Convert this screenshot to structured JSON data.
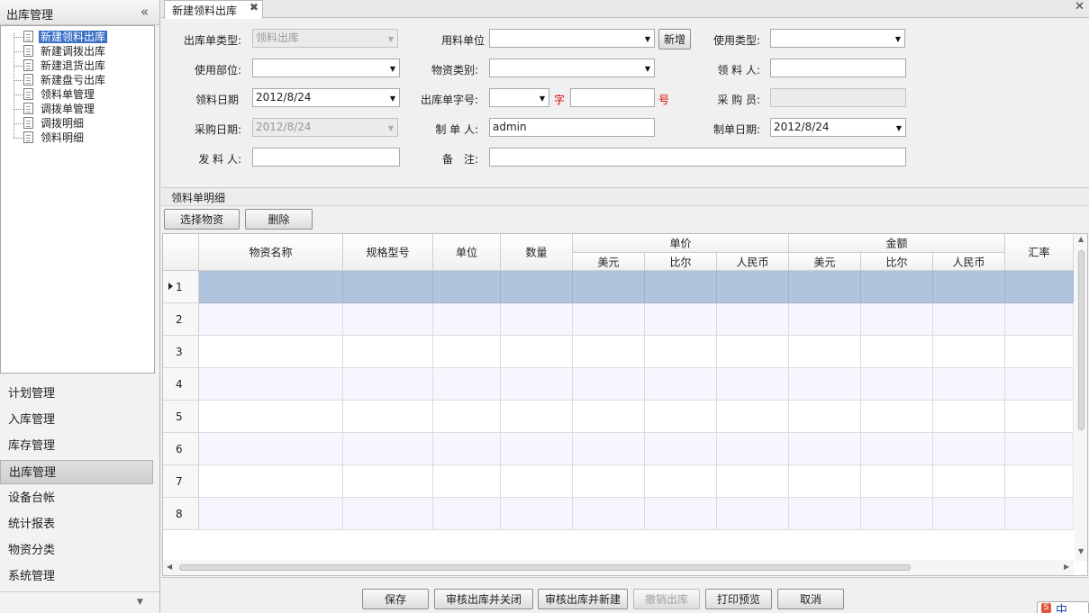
{
  "sidebar": {
    "title": "出库管理",
    "collapse_icon": "«",
    "tree": [
      {
        "label": "新建领料出库",
        "selected": true
      },
      {
        "label": "新建调拨出库"
      },
      {
        "label": "新建退货出库"
      },
      {
        "label": "新建盘亏出库"
      },
      {
        "label": "领料单管理"
      },
      {
        "label": "调拨单管理"
      },
      {
        "label": "调拨明细"
      },
      {
        "label": "领料明细"
      }
    ],
    "nav": [
      {
        "label": "计划管理"
      },
      {
        "label": "入库管理"
      },
      {
        "label": "库存管理"
      },
      {
        "label": "出库管理",
        "active": true
      },
      {
        "label": "设备台帐"
      },
      {
        "label": "统计报表"
      },
      {
        "label": "物资分类"
      },
      {
        "label": "系统管理"
      }
    ],
    "more_icon": "▼"
  },
  "tab": {
    "label": "新建领料出库",
    "close_icon": "✖"
  },
  "window_close_icon": "✕",
  "form": {
    "outbound_type_label": "出库单类型:",
    "outbound_type_value": "领料出库",
    "use_unit_label": "用料单位",
    "use_unit_value": "",
    "add_button": "新增",
    "usage_type_label": "使用类型:",
    "usage_type_value": "",
    "use_dept_label": "使用部位:",
    "use_dept_value": "",
    "material_category_label": "物资类别:",
    "material_category_value": "",
    "receiver_label": "领 料 人:",
    "receiver_value": "",
    "receive_date_label": "领料日期",
    "receive_date_value": "2012/8/24",
    "outbound_no_label": "出库单字号:",
    "outbound_no_prefix": "",
    "char_label": "字",
    "outbound_no_number": "",
    "number_label": "号",
    "purchaser_label": "采 购 员:",
    "purchaser_value": "",
    "purchase_date_label": "采购日期:",
    "purchase_date_value": "2012/8/24",
    "creator_label": "制 单 人:",
    "creator_value": "admin",
    "create_date_label": "制单日期:",
    "create_date_value": "2012/8/24",
    "issuer_label": "发 料 人:",
    "issuer_value": "",
    "remark_label": "备　注:",
    "remark_value": ""
  },
  "detail": {
    "title": "领料单明细",
    "select_button": "选择物资",
    "delete_button": "删除"
  },
  "grid": {
    "headers": {
      "name": "物资名称",
      "spec": "规格型号",
      "unit": "单位",
      "qty": "数量",
      "unit_price": "单价",
      "amount": "金额",
      "usd": "美元",
      "birr": "比尔",
      "rmb": "人民币",
      "rate": "汇率"
    },
    "rows": [
      "1",
      "2",
      "3",
      "4",
      "5",
      "6",
      "7",
      "8"
    ]
  },
  "footer": {
    "save": "保存",
    "approve_close": "审核出库并关闭",
    "approve_new": "审核出库并新建",
    "cancel_outbound": "撤销出库",
    "print_preview": "打印预览",
    "cancel": "取消"
  },
  "ime": {
    "icon": "S",
    "label": "中"
  },
  "colors": {
    "selected_row": "#b0c4de",
    "alt_row": "#f7f5fd",
    "tree_selection": "#3a6fc7",
    "red_text": "#dd0000"
  }
}
